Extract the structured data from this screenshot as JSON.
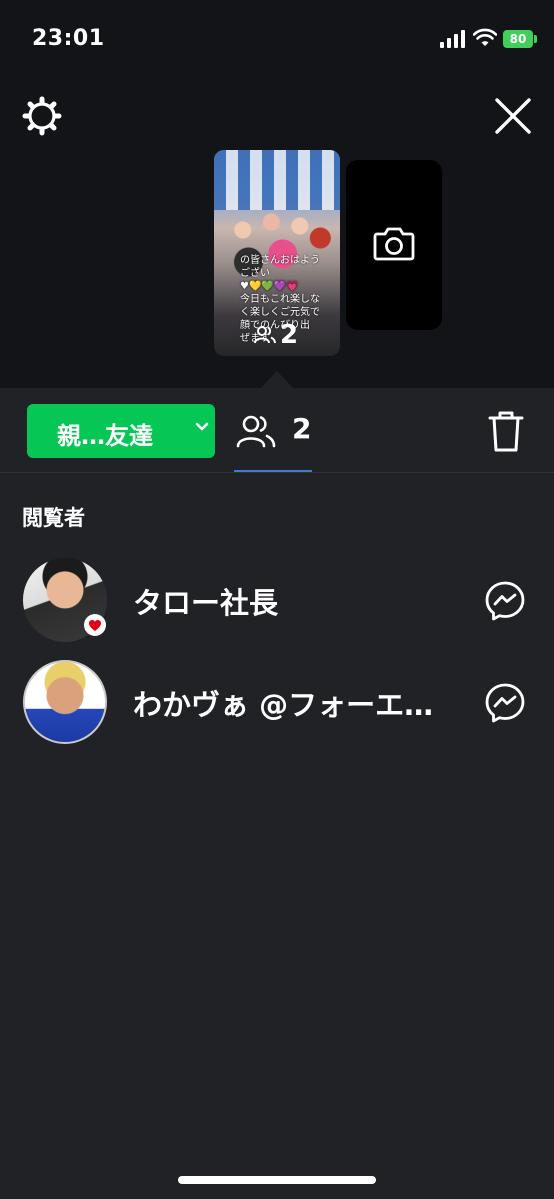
{
  "status_bar": {
    "time": "23:01",
    "battery": "80"
  },
  "story": {
    "text": "の皆さんおはよう\nござい\n♥💛💚💜💗\n今日もこれ楽しな\nく楽しくご元気で\n顔でのんびり出\nぜます",
    "viewer_count": "2"
  },
  "toolbar": {
    "audience_label": "親…友達",
    "viewer_count": "2"
  },
  "viewers_section": {
    "title": "閲覧者",
    "viewers": [
      {
        "name": "タロー社長",
        "liked": true
      },
      {
        "name": "わかヴぁ @フォーエ…",
        "liked": false
      }
    ]
  },
  "colors": {
    "accent_green": "#06c755",
    "tab_underline": "#3c7bd6",
    "heart": "#e60012"
  }
}
